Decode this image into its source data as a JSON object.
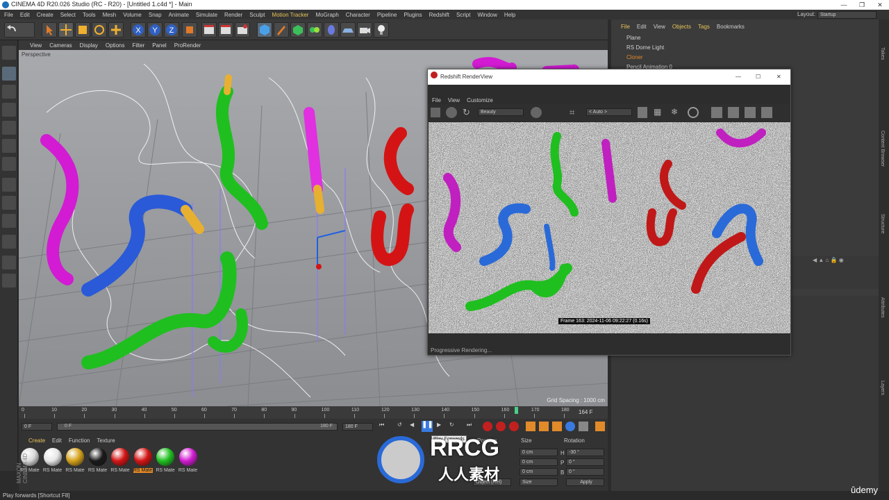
{
  "window": {
    "title": "CINEMA 4D R20.026 Studio (RC - R20) - [Untitled 1.c4d *] - Main"
  },
  "menubar": {
    "items": [
      "File",
      "Edit",
      "Create",
      "Select",
      "Tools",
      "Mesh",
      "Volume",
      "Snap",
      "Animate",
      "Simulate",
      "Render",
      "Sculpt",
      "Motion Tracker",
      "MoGraph",
      "Character",
      "Pipeline",
      "Plugins",
      "Redshift",
      "Script",
      "Window",
      "Help"
    ],
    "highlighted": "Motion Tracker"
  },
  "layout": {
    "label": "Layout:",
    "value": "Startup"
  },
  "viewport": {
    "menu": [
      "View",
      "Cameras",
      "Display",
      "Options",
      "Filter",
      "Panel",
      "ProRender"
    ],
    "camera_label": "Perspective",
    "grid_spacing": "Grid Spacing : 1000 cm"
  },
  "timeline": {
    "ticks": [
      "0",
      "10",
      "20",
      "30",
      "40",
      "50",
      "60",
      "70",
      "80",
      "90",
      "100",
      "110",
      "120",
      "130",
      "140",
      "150",
      "160",
      "170",
      "180"
    ],
    "current_frame": "164 F",
    "playhead_fraction": 0.911
  },
  "anim": {
    "start_field": "0 F",
    "range_start": "0 F",
    "range_end": "180 F",
    "end_field": "180 F",
    "tooltip": "Play Forwards"
  },
  "material_manager": {
    "menu": [
      "Create",
      "Edit",
      "Function",
      "Texture"
    ],
    "materials": [
      {
        "label": "RS Mate",
        "color": "#d9d9d9",
        "selected": false
      },
      {
        "label": "RS Mate",
        "color": "#e6e6e6",
        "selected": false
      },
      {
        "label": "RS Mate",
        "color": "#d4a11a",
        "selected": false
      },
      {
        "label": "RS Mate",
        "color": "#1a1a1a",
        "selected": false
      },
      {
        "label": "RS Mate",
        "color": "#d41414",
        "selected": false
      },
      {
        "label": "RS Mate",
        "color": "#d41414",
        "selected": true
      },
      {
        "label": "RS Mate",
        "color": "#1fbf1f",
        "selected": false
      },
      {
        "label": "RS Mate",
        "color": "#d21bd2",
        "selected": false
      }
    ]
  },
  "attributes": {
    "headers": [
      "Position",
      "Size",
      "Rotation"
    ],
    "rows": [
      {
        "size": "0 cm",
        "rot_label": "H",
        "rot": "-30 °"
      },
      {
        "size": "0 cm",
        "rot_label": "P",
        "rot": "0 °"
      },
      {
        "size": "0 cm",
        "rot_label": "B",
        "rot": "0 °"
      }
    ],
    "mode": "Object (Rel)",
    "size_mode": "Size",
    "apply": "Apply"
  },
  "object_manager": {
    "menu": [
      "File",
      "Edit",
      "View",
      "Objects",
      "Tags",
      "Bookmarks"
    ],
    "active_menu": [
      "File",
      "Objects",
      "Tags"
    ],
    "objects": [
      {
        "name": "Plane",
        "color": "#d0d0d0"
      },
      {
        "name": "RS Dome Light",
        "color": "#d0d0d0"
      },
      {
        "name": "Cloner",
        "color": "#e08a2a"
      },
      {
        "name": "Pencil Animation 0",
        "color": "#d0d0d0"
      }
    ]
  },
  "renderview": {
    "title": "Redshift RenderView",
    "menu": [
      "File",
      "View",
      "Customize"
    ],
    "aov": "Beauty",
    "camera": "< Auto >",
    "frame_info": "Frame  163:  2024-11-06  09:22:27  (0.16s)",
    "status": "Progressive Rendering..."
  },
  "right_tabs": [
    "Takes",
    "Content Browser",
    "Structure",
    "Attributes",
    "Layers"
  ],
  "statusbar": "Play forwards [Shortcut F8]",
  "branding": {
    "udemy": "ûdemy",
    "watermark_big": "RRCG",
    "watermark_small": "人人素材",
    "maxon": "MAXON CINEMA 4D"
  },
  "colors": {
    "accent": "#e8c45a",
    "viewport_bg": "#8f9196",
    "panel": "#333333"
  }
}
